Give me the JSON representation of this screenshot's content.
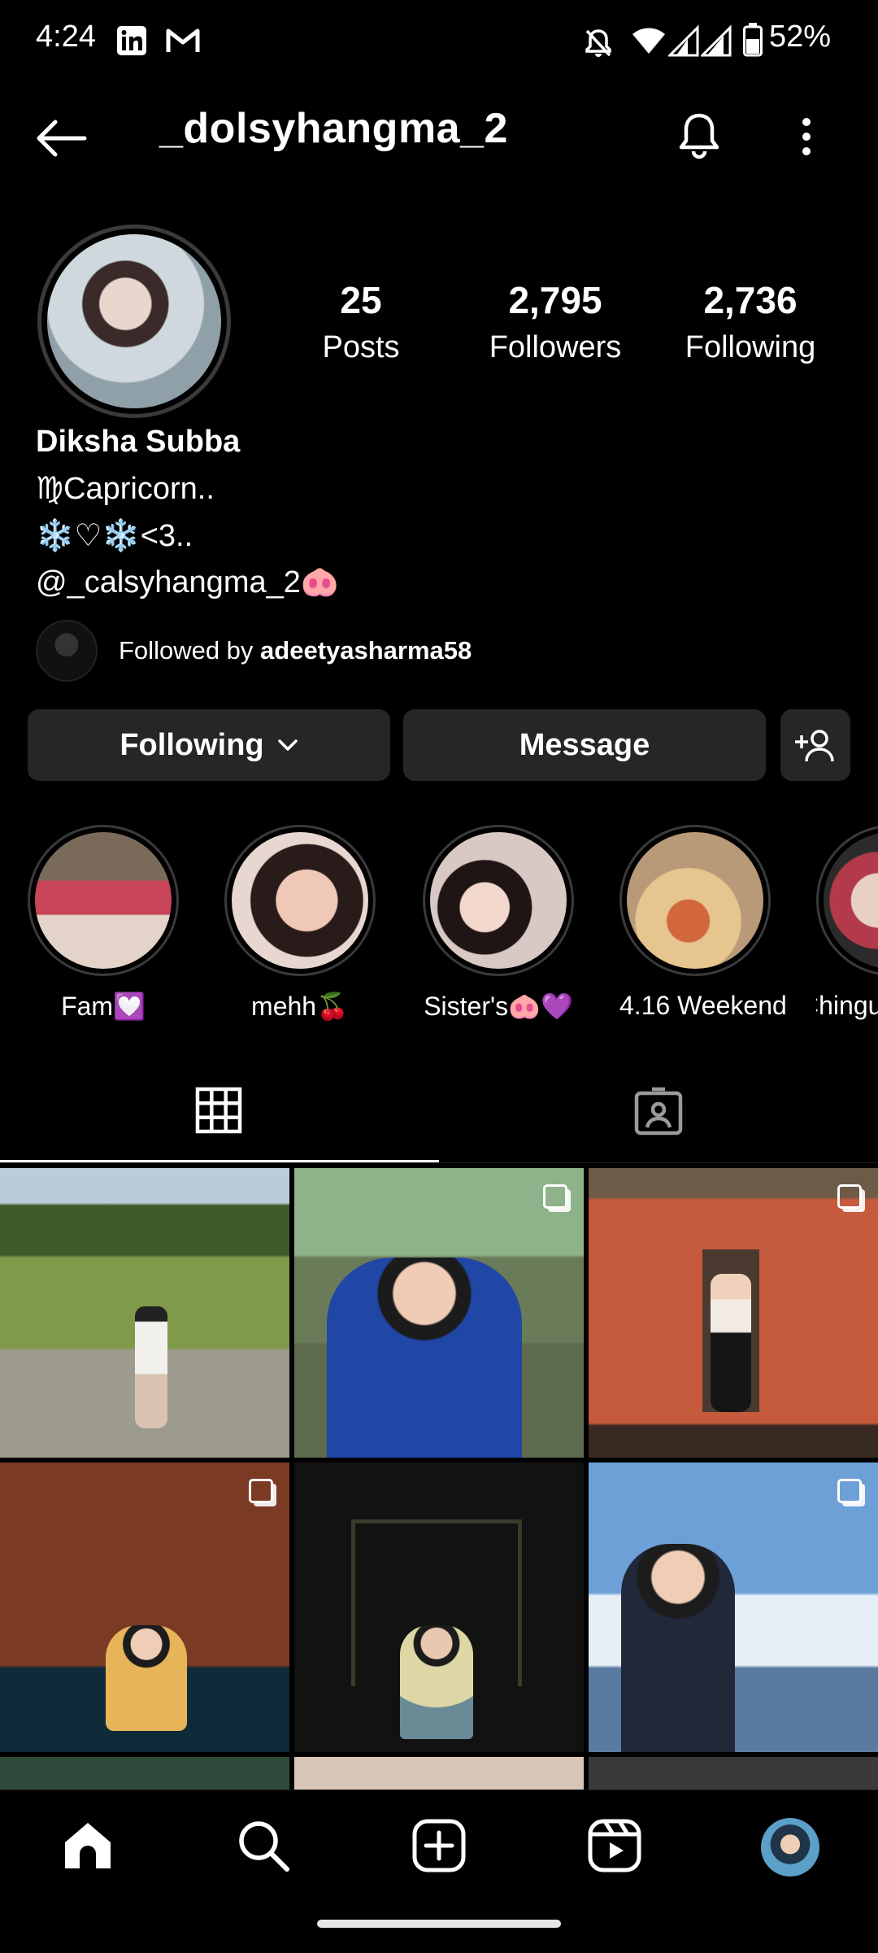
{
  "status_bar": {
    "time": "4:24",
    "battery": "52%",
    "icons": [
      "linkedin-icon",
      "gmail-icon",
      "mute-icon",
      "wifi-icon",
      "signal-icon",
      "battery-icon"
    ]
  },
  "header": {
    "username": "_dolsyhangma_2",
    "back_icon": "back-arrow-icon",
    "bell_icon": "bell-icon",
    "more_icon": "more-vertical-icon"
  },
  "stats": [
    {
      "value": "25",
      "label": "Posts"
    },
    {
      "value": "2,795",
      "label": "Followers"
    },
    {
      "value": "2,736",
      "label": "Following"
    }
  ],
  "bio": {
    "name": "Diksha Subba",
    "line1": "♍Capricorn..",
    "line2": "❄️♡❄️<3..",
    "line3": "@_calsyhangma_2🐽"
  },
  "followed_by": {
    "prefix": "Followed by ",
    "user": "adeetyasharma58"
  },
  "buttons": {
    "following": "Following",
    "message": "Message"
  },
  "highlights": [
    {
      "label": "Fam💟"
    },
    {
      "label": "mehh🍒"
    },
    {
      "label": "Sister's🐽💜"
    },
    {
      "label": "4.16 Weekend"
    },
    {
      "label": "Chingu"
    }
  ],
  "tabs": [
    {
      "name": "grid",
      "icon": "grid-icon",
      "active": true
    },
    {
      "name": "tagged",
      "icon": "tagged-icon",
      "active": false
    }
  ],
  "colors": {
    "background": "#000000",
    "button_bg": "#262626",
    "text": "#ffffff"
  },
  "nav": [
    "home-icon",
    "search-icon",
    "create-icon",
    "reels-icon",
    "profile-avatar"
  ]
}
